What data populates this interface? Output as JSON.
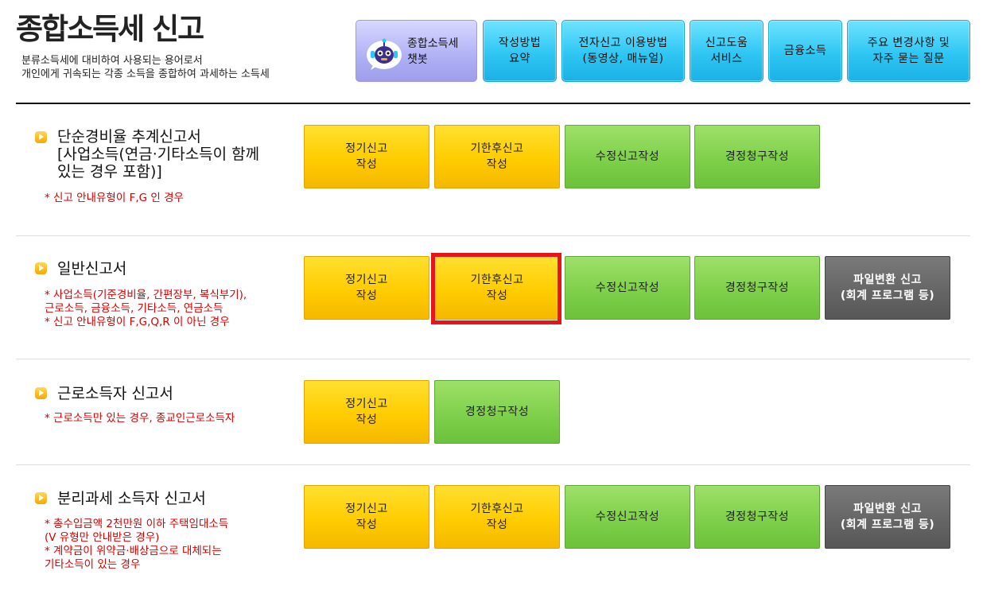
{
  "header": {
    "title": "종합소득세 신고",
    "subtitle": "분류소득세에 대비하여 사용되는 용어로서\n개인에게 귀속되는 각종 소득을 종합하여 과세하는 소득세"
  },
  "top_nav": {
    "chatbot_label": "종합소득세\n챗봇",
    "items": [
      {
        "label": "작성방법\n요약"
      },
      {
        "label": "전자신고 이용방법\n(동영상, 매뉴얼)"
      },
      {
        "label": "신고도움\n서비스"
      },
      {
        "label": "금융소득"
      },
      {
        "label": "주요 변경사항 및\n자주 묻는 질문"
      }
    ]
  },
  "sections": [
    {
      "title": "단순경비율 추계신고서\n[사업소득(연금·기타소득이 함께\n있는 경우 포함)]",
      "notes": "* 신고 안내유형이 F,G 인 경우",
      "buttons": [
        {
          "label": "정기신고\n작성"
        },
        {
          "label": "기한후신고\n작성"
        },
        {
          "label": "수정신고작성"
        },
        {
          "label": "경정청구작성"
        }
      ]
    },
    {
      "title": "일반신고서",
      "notes": "* 사업소득(기준경비율, 간편장부, 복식부기),\n  근로소득, 금융소득, 기타소득, 연금소득\n* 신고 안내유형이 F,G,Q,R 이 아닌 경우",
      "buttons": [
        {
          "label": "정기신고\n작성"
        },
        {
          "label": "기한후신고\n작성"
        },
        {
          "label": "수정신고작성"
        },
        {
          "label": "경정청구작성"
        },
        {
          "label": "파일변환 신고\n(회계 프로그램 등)"
        }
      ]
    },
    {
      "title": "근로소득자 신고서",
      "notes": "* 근로소득만 있는 경우, 종교인근로소득자",
      "buttons": [
        {
          "label": "정기신고\n작성"
        },
        {
          "label": "경정청구작성"
        }
      ]
    },
    {
      "title": "분리과세 소득자 신고서",
      "notes": "* 총수입금액 2천만원 이하 주택임대소득\n  (V 유형만 안내받은 경우)\n* 계약금이 위약금·배상금으로 대체되는\n  기타소득이 있는 경우",
      "buttons": [
        {
          "label": "정기신고\n작성"
        },
        {
          "label": "기한후신고\n작성"
        },
        {
          "label": "수정신고작성"
        },
        {
          "label": "경정청구작성"
        },
        {
          "label": "파일변환 신고\n(회계 프로그램 등)"
        }
      ]
    }
  ],
  "colors": {
    "accent_yellow": "#ffcc00",
    "accent_green": "#7fd04a",
    "accent_dark": "#646464",
    "nav_blue": "#2fc6f3",
    "highlight_red": "#e8141c",
    "note_red": "#d30000"
  }
}
